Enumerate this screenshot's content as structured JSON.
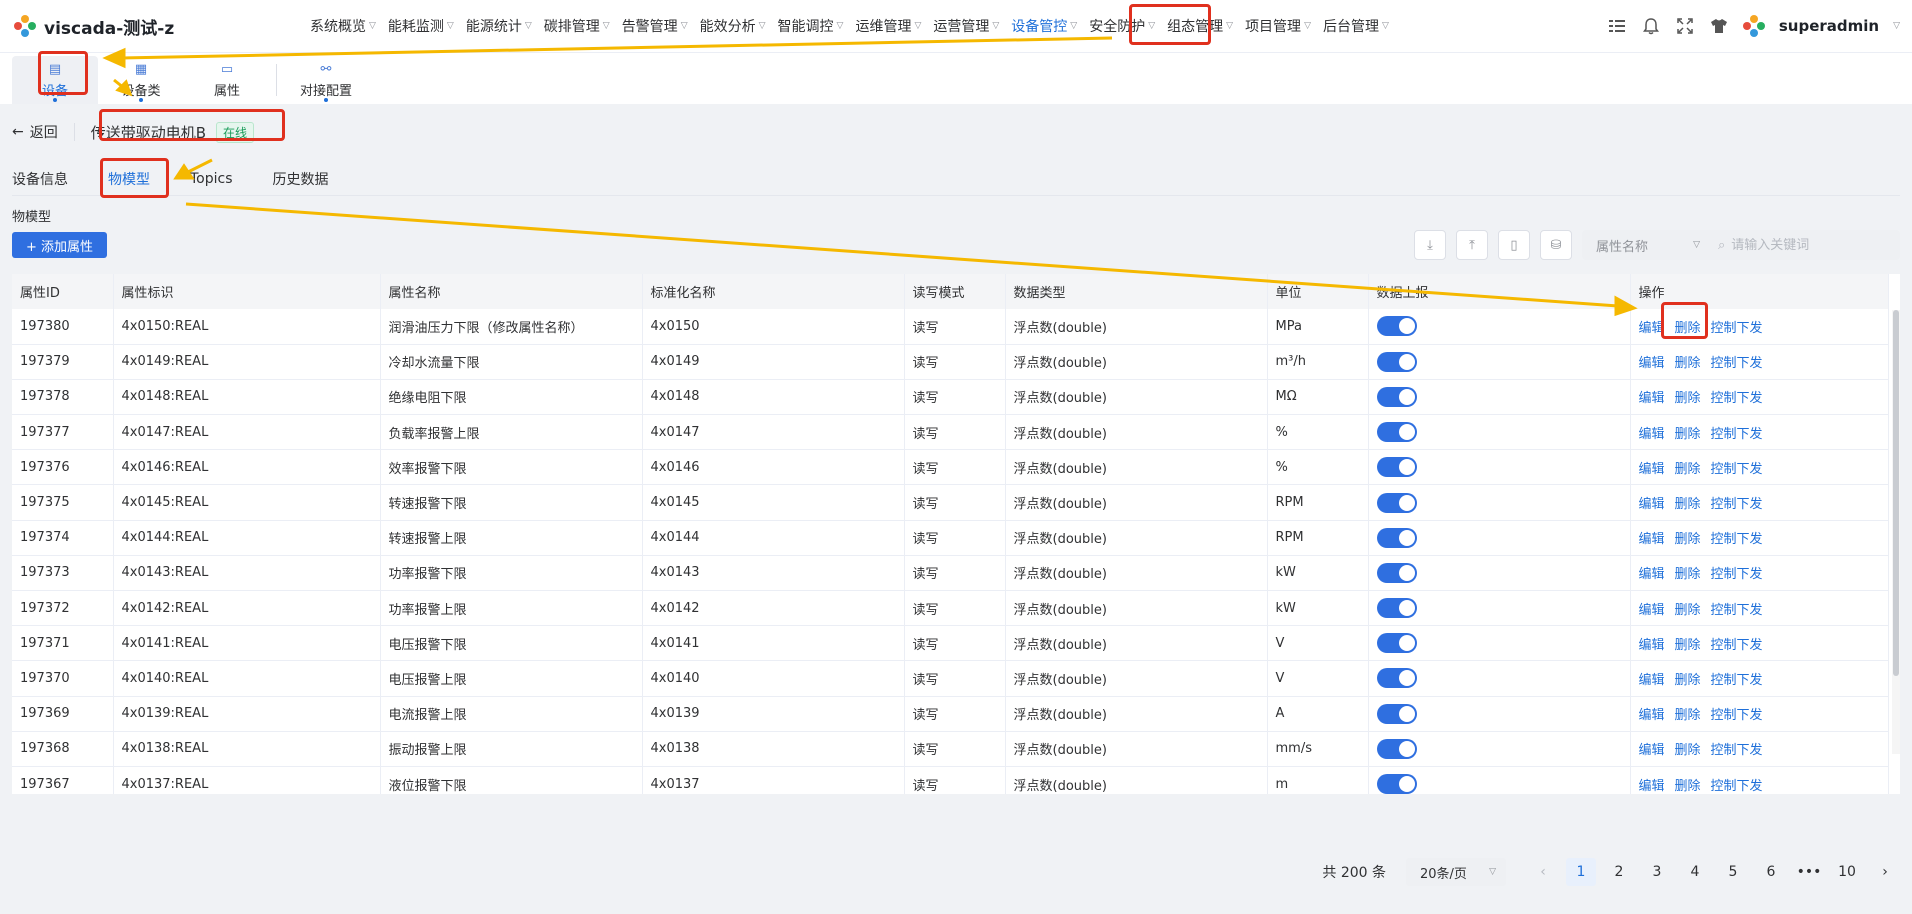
{
  "app": {
    "title": "viscada-测试-z",
    "username": "superadmin"
  },
  "topnav": {
    "items": [
      {
        "label": "系统概览"
      },
      {
        "label": "能耗监测"
      },
      {
        "label": "能源统计"
      },
      {
        "label": "碳排管理"
      },
      {
        "label": "告警管理"
      },
      {
        "label": "能效分析"
      },
      {
        "label": "智能调控"
      },
      {
        "label": "运维管理"
      },
      {
        "label": "运营管理"
      },
      {
        "label": "设备管控",
        "active": true
      },
      {
        "label": "安全防护"
      },
      {
        "label": "组态管理"
      },
      {
        "label": "项目管理"
      },
      {
        "label": "后台管理"
      }
    ],
    "icons": [
      "list-icon",
      "bell-icon",
      "fullscreen-icon",
      "shirt-icon"
    ]
  },
  "subnav": {
    "items": [
      {
        "label": "设备",
        "icon": "device-icon",
        "active": true
      },
      {
        "label": "设备类",
        "icon": "device-class-icon"
      },
      {
        "label": "属性",
        "icon": "property-icon"
      },
      {
        "label": "对接配置",
        "icon": "integration-icon"
      }
    ]
  },
  "device": {
    "back_label": "返回",
    "name": "传送带驱动电机B",
    "status": "在线"
  },
  "tabs": [
    {
      "label": "设备信息"
    },
    {
      "label": "物模型",
      "active": true
    },
    {
      "label": "Topics"
    },
    {
      "label": "历史数据"
    }
  ],
  "panel": {
    "title": "物模型",
    "add_button": "+ 添加属性",
    "search_field_label": "属性名称",
    "search_placeholder": "请输入关键词"
  },
  "table": {
    "columns": [
      "属性ID",
      "属性标识",
      "属性名称",
      "标准化名称",
      "读写模式",
      "数据类型",
      "单位",
      "数据上报",
      "操作"
    ],
    "actions": [
      "编辑",
      "删除",
      "控制下发"
    ],
    "rows": [
      [
        "197380",
        "4x0150:REAL",
        "润滑油压力下限（修改属性名称）",
        "4x0150",
        "读写",
        "浮点数(double)",
        "MPa"
      ],
      [
        "197379",
        "4x0149:REAL",
        "冷却水流量下限",
        "4x0149",
        "读写",
        "浮点数(double)",
        "m³/h"
      ],
      [
        "197378",
        "4x0148:REAL",
        "绝缘电阻下限",
        "4x0148",
        "读写",
        "浮点数(double)",
        "MΩ"
      ],
      [
        "197377",
        "4x0147:REAL",
        "负载率报警上限",
        "4x0147",
        "读写",
        "浮点数(double)",
        "%"
      ],
      [
        "197376",
        "4x0146:REAL",
        "效率报警下限",
        "4x0146",
        "读写",
        "浮点数(double)",
        "%"
      ],
      [
        "197375",
        "4x0145:REAL",
        "转速报警下限",
        "4x0145",
        "读写",
        "浮点数(double)",
        "RPM"
      ],
      [
        "197374",
        "4x0144:REAL",
        "转速报警上限",
        "4x0144",
        "读写",
        "浮点数(double)",
        "RPM"
      ],
      [
        "197373",
        "4x0143:REAL",
        "功率报警下限",
        "4x0143",
        "读写",
        "浮点数(double)",
        "kW"
      ],
      [
        "197372",
        "4x0142:REAL",
        "功率报警上限",
        "4x0142",
        "读写",
        "浮点数(double)",
        "kW"
      ],
      [
        "197371",
        "4x0141:REAL",
        "电压报警下限",
        "4x0141",
        "读写",
        "浮点数(double)",
        "V"
      ],
      [
        "197370",
        "4x0140:REAL",
        "电压报警上限",
        "4x0140",
        "读写",
        "浮点数(double)",
        "V"
      ],
      [
        "197369",
        "4x0139:REAL",
        "电流报警上限",
        "4x0139",
        "读写",
        "浮点数(double)",
        "A"
      ],
      [
        "197368",
        "4x0138:REAL",
        "振动报警上限",
        "4x0138",
        "读写",
        "浮点数(double)",
        "mm/s"
      ],
      [
        "197367",
        "4x0137:REAL",
        "液位报警下限",
        "4x0137",
        "读写",
        "浮点数(double)",
        "m"
      ]
    ]
  },
  "pagination": {
    "total": "共 200 条",
    "page_size": "20条/页",
    "pages": [
      "1",
      "2",
      "3",
      "4",
      "5",
      "6",
      "•••",
      "10"
    ],
    "current": "1"
  },
  "colors": {
    "primary": "#2f6fe0",
    "annotation_red": "#e0301e",
    "annotation_arrow": "#f5b800"
  }
}
